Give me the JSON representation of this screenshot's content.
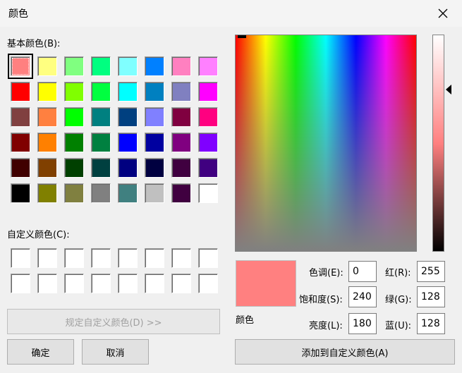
{
  "window": {
    "title": "颜色"
  },
  "basic": {
    "label": "基本颜色(B):",
    "rows": [
      [
        "#ff8080",
        "#ffff80",
        "#80ff80",
        "#00ff80",
        "#80ffff",
        "#0080ff",
        "#ff80c0",
        "#ff80ff"
      ],
      [
        "#ff0000",
        "#ffff00",
        "#80ff00",
        "#00ff40",
        "#00ffff",
        "#0080c0",
        "#8080c0",
        "#ff00ff"
      ],
      [
        "#804040",
        "#ff8040",
        "#00ff00",
        "#008080",
        "#004080",
        "#8080ff",
        "#800040",
        "#ff0080"
      ],
      [
        "#800000",
        "#ff8000",
        "#008000",
        "#008040",
        "#0000ff",
        "#0000a0",
        "#800080",
        "#8000ff"
      ],
      [
        "#400000",
        "#804000",
        "#004000",
        "#004040",
        "#000080",
        "#000040",
        "#400040",
        "#400080"
      ],
      [
        "#000000",
        "#808000",
        "#808040",
        "#808080",
        "#408080",
        "#c0c0c0",
        "#400040",
        "#ffffff"
      ]
    ]
  },
  "custom": {
    "label": "自定义颜色(C):",
    "rows": [
      [
        "#ffffff",
        "#ffffff",
        "#ffffff",
        "#ffffff",
        "#ffffff",
        "#ffffff",
        "#ffffff",
        "#ffffff"
      ],
      [
        "#ffffff",
        "#ffffff",
        "#ffffff",
        "#ffffff",
        "#ffffff",
        "#ffffff",
        "#ffffff",
        "#ffffff"
      ]
    ]
  },
  "buttons": {
    "define_custom": "规定自定义颜色(D) >>",
    "ok": "确定",
    "cancel": "取消",
    "add_custom": "添加到自定义颜色(A)"
  },
  "preview": {
    "label": "颜色",
    "color": "#ff8080"
  },
  "fields": {
    "hue_label": "色调(E):",
    "hue": "0",
    "sat_label": "饱和度(S):",
    "sat": "240",
    "lum_label": "亮度(L):",
    "lum": "180",
    "red_label": "红(R):",
    "red": "255",
    "green_label": "绿(G):",
    "green": "128",
    "blue_label": "蓝(U):",
    "blue": "128"
  },
  "icons": {
    "close": "close-icon",
    "luminance_marker": "triangle-left-icon"
  }
}
